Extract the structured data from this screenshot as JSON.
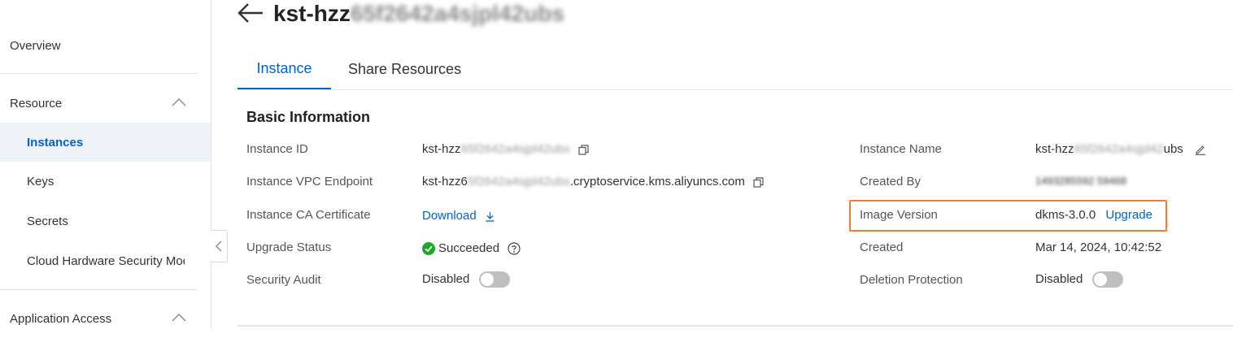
{
  "sidebar": {
    "overview": "Overview",
    "resource_group": "Resource",
    "instances": "Instances",
    "keys": "Keys",
    "secrets": "Secrets",
    "hsm": "Cloud Hardware Security Module",
    "app_access": "Application Access"
  },
  "header": {
    "title_prefix": "kst-hzz",
    "title_redacted": "65f2642a4sjpl42ubs"
  },
  "tabs": {
    "instance": "Instance",
    "share_resources": "Share Resources"
  },
  "basic_info": {
    "title": "Basic Information",
    "instance_id_label": "Instance ID",
    "instance_id_prefix": "kst-hzz",
    "instance_id_redacted": "65f2642a4sjpl42ubs",
    "vpc_endpoint_label": "Instance VPC Endpoint",
    "vpc_endpoint_prefix": "kst-hzz6",
    "vpc_endpoint_redacted": "5f2642a4sjpl42ubs",
    "vpc_endpoint_suffix": ".cryptoservice.kms.aliyuncs.com",
    "ca_cert_label": "Instance CA Certificate",
    "ca_cert_link": "Download",
    "upgrade_status_label": "Upgrade Status",
    "upgrade_status_value": "Succeeded",
    "security_audit_label": "Security Audit",
    "security_audit_value": "Disabled",
    "instance_name_label": "Instance Name",
    "instance_name_prefix": "kst-hzz",
    "instance_name_redacted": "65f2642a4sjpl42",
    "instance_name_suffix": "ubs",
    "created_by_label": "Created By",
    "created_by_redacted": "1493285592 59468",
    "image_version_label": "Image Version",
    "image_version_value": "dkms-3.0.0",
    "upgrade_link": "Upgrade",
    "created_label": "Created",
    "created_value": "Mar 14, 2024, 10:42:52",
    "deletion_protection_label": "Deletion Protection",
    "deletion_protection_value": "Disabled"
  },
  "colors": {
    "accent": "#0064c8",
    "highlight": "#ed7d31",
    "success": "#1ca72c",
    "toggle_off": "#bfbfbf"
  }
}
